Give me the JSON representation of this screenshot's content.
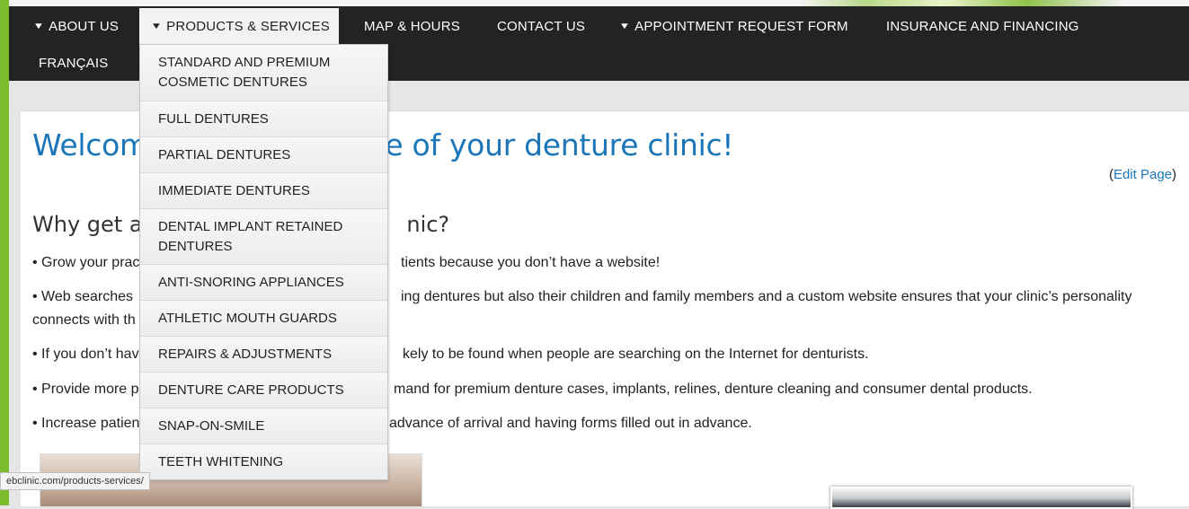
{
  "nav": {
    "about": "ABOUT US",
    "products": "PRODUCTS & SERVICES",
    "map": "MAP & HOURS",
    "contact": "CONTACT US",
    "appointment": "APPOINTMENT REQUEST FORM",
    "insurance": "INSURANCE AND FINANCING",
    "francais": "FRANÇAIS"
  },
  "dropdown": {
    "items": [
      "STANDARD AND PREMIUM COSMETIC DENTURES",
      "FULL DENTURES",
      "PARTIAL DENTURES",
      "IMMEDIATE DENTURES",
      "DENTAL IMPLANT RETAINED DENTURES",
      "ANTI-SNORING APPLIANCES",
      "ATHLETIC MOUTH GUARDS",
      "REPAIRS & ADJUSTMENTS",
      "DENTURE CARE PRODUCTS",
      "SNAP-ON-SMILE",
      "TEETH WHITENING"
    ]
  },
  "page": {
    "title_left": "Welcome",
    "title_right": "ite of your denture clinic!",
    "edit_open": "(",
    "edit_link": "Edit Page",
    "edit_close": ")",
    "subtitle_left": "Why get a v",
    "subtitle_right": "nic?",
    "bullets": [
      {
        "left": "• Grow your prac",
        "right": "tients because you don’t have a website!"
      },
      {
        "left": "• Web searches",
        "right": "ing dentures but also their children and family members and a custom website ensures that your clinic’s personality"
      },
      {
        "left": "connects with th",
        "right": ""
      },
      {
        "left": "• If you don’t hav",
        "right": "kely to be found when people are searching on the Internet for denturists."
      },
      {
        "left": "• Provide more p",
        "right": "mand for premium denture cases, implants, relines, denture cleaning and consumer dental products."
      },
      {
        "left": "• Increase patien",
        "right": "advance of arrival and having forms filled out in advance."
      }
    ]
  },
  "status_bar": {
    "url": "ebclinic.com/products-services/"
  },
  "colors": {
    "nav_bg": "#232323",
    "accent_green": "#7dbb2e",
    "heading_blue": "#1b76b9"
  },
  "icons": {
    "nav_chevron": "chevron-down-icon"
  }
}
